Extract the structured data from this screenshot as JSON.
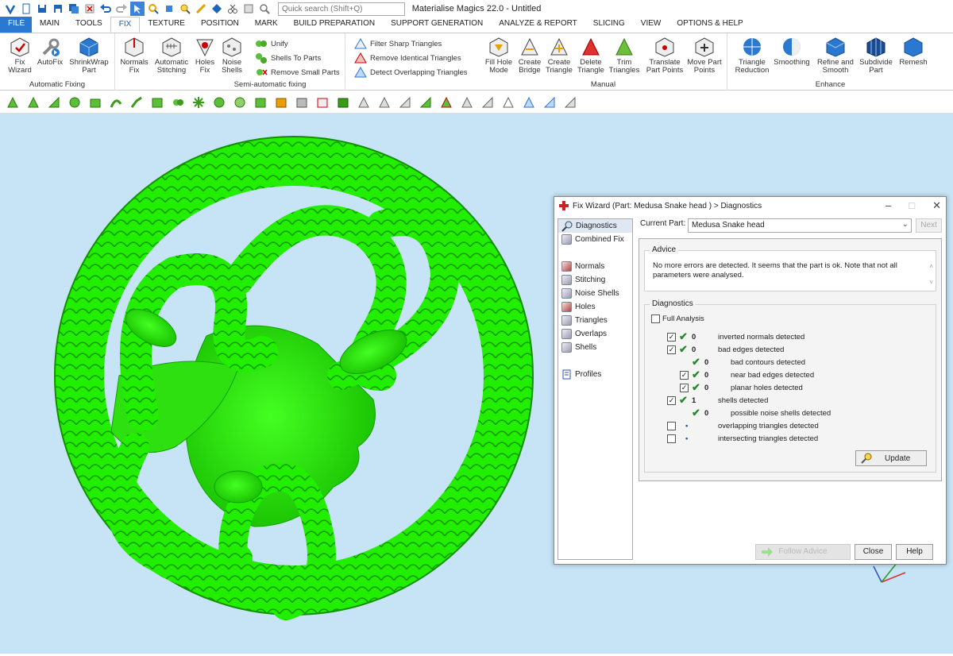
{
  "app_title": "Materialise Magics 22.0 - Untitled",
  "search_placeholder": "Quick search (Shift+Q)",
  "tabs": [
    "FILE",
    "MAIN",
    "TOOLS",
    "FIX",
    "TEXTURE",
    "POSITION",
    "MARK",
    "BUILD PREPARATION",
    "SUPPORT GENERATION",
    "ANALYZE & REPORT",
    "SLICING",
    "VIEW",
    "OPTIONS & HELP"
  ],
  "active_tab": "FIX",
  "ribbon": {
    "auto_fix_group": "Automatic Fixing",
    "fix_wizard": "Fix\nWizard",
    "autofix": "AutoFix",
    "shrinkwrap": "ShrinkWrap\nPart",
    "semi_group": "Semi-automatic fixing",
    "normals_fix": "Normals\nFix",
    "auto_stitching": "Automatic\nStitching",
    "holes_fix": "Holes\nFix",
    "noise_shells": "Noise\nShells",
    "unify": "Unify",
    "shells_to_parts": "Shells To Parts",
    "remove_small_parts": "Remove Small Parts",
    "filter_sharp": "Filter Sharp Triangles",
    "remove_identical": "Remove Identical Triangles",
    "detect_overlapping": "Detect Overlapping Triangles",
    "manual_group": "Manual",
    "fill_hole_mode": "Fill Hole\nMode",
    "create_bridge": "Create\nBridge",
    "create_triangle": "Create\nTriangle",
    "delete_triangle": "Delete\nTriangle",
    "trim_triangles": "Trim\nTriangles",
    "translate_points": "Translate\nPart Points",
    "move_points": "Move Part\nPoints",
    "enhance_group": "Enhance",
    "triangle_reduction": "Triangle\nReduction",
    "smoothing": "Smoothing",
    "refine_smooth": "Refine and\nSmooth",
    "subdivide": "Subdivide\nPart",
    "remesh": "Remesh"
  },
  "dialog": {
    "title": "Fix Wizard (Part: Medusa Snake head ) > Diagnostics",
    "nav_top": [
      "Diagnostics",
      "Combined Fix"
    ],
    "nav_mid": [
      "Normals",
      "Stitching",
      "Noise Shells",
      "Holes",
      "Triangles",
      "Overlaps",
      "Shells"
    ],
    "nav_bottom": [
      "Profiles"
    ],
    "current_part_label": "Current Part:",
    "current_part": "Medusa Snake head",
    "next": "Next",
    "advice_label": "Advice",
    "advice_text": "No more errors are detected. It seems that the part is ok. Note that not all parameters were analysed.",
    "diagnostics_label": "Diagnostics",
    "full_analysis": "Full Analysis",
    "rows": [
      {
        "checked": true,
        "status": "ok",
        "count": "0",
        "label": "inverted normals detected",
        "indent": 0
      },
      {
        "checked": true,
        "status": "ok",
        "count": "0",
        "label": "bad edges detected",
        "indent": 0
      },
      {
        "checked": null,
        "status": "ok",
        "count": "0",
        "label": "bad contours detected",
        "indent": 1
      },
      {
        "checked": true,
        "status": "ok",
        "count": "0",
        "label": "near bad edges detected",
        "indent": 1
      },
      {
        "checked": true,
        "status": "ok",
        "count": "0",
        "label": "planar holes detected",
        "indent": 1
      },
      {
        "checked": true,
        "status": "ok",
        "count": "1",
        "label": "shells detected",
        "indent": 0
      },
      {
        "checked": null,
        "status": "ok",
        "count": "0",
        "label": "possible noise shells detected",
        "indent": 1
      },
      {
        "checked": false,
        "status": "dot",
        "count": "",
        "label": "overlapping triangles detected",
        "indent": 0
      },
      {
        "checked": false,
        "status": "dot",
        "count": "",
        "label": "intersecting triangles detected",
        "indent": 0
      }
    ],
    "update": "Update",
    "follow_advice": "Follow Advice",
    "close": "Close",
    "help": "Help"
  },
  "colors": {
    "model": "#22ee00",
    "viewport": "#c6e4f5",
    "accent": "#2b78d0"
  }
}
